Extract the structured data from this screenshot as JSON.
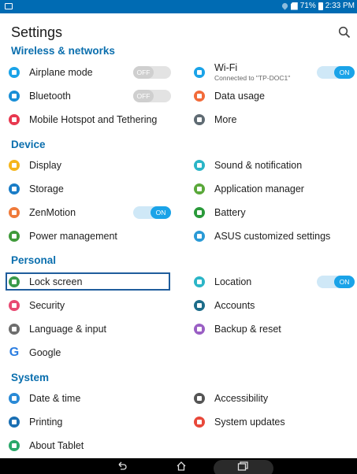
{
  "status_bar": {
    "battery": "71%",
    "time": "2:33 PM"
  },
  "header": {
    "title": "Settings",
    "search_icon": "search-icon"
  },
  "sections": {
    "wireless": "Wireless & networks",
    "device": "Device",
    "personal": "Personal",
    "system": "System"
  },
  "items": {
    "airplane": "Airplane mode",
    "wifi": "Wi-Fi",
    "wifi_sub": "Connected to \"TP-DOC1\"",
    "bluetooth": "Bluetooth",
    "data_usage": "Data usage",
    "hotspot": "Mobile Hotspot and Tethering",
    "more": "More",
    "display": "Display",
    "sound": "Sound & notification",
    "storage": "Storage",
    "app_manager": "Application manager",
    "zenmotion": "ZenMotion",
    "battery": "Battery",
    "power": "Power management",
    "asus_custom": "ASUS customized settings",
    "lock_screen": "Lock screen",
    "location": "Location",
    "security": "Security",
    "accounts": "Accounts",
    "language": "Language & input",
    "backup": "Backup & reset",
    "google": "Google",
    "date_time": "Date & time",
    "accessibility": "Accessibility",
    "printing": "Printing",
    "system_updates": "System updates",
    "about": "About Tablet"
  },
  "toggles": {
    "off": "OFF",
    "on": "ON"
  },
  "colors": {
    "accent": "#0b6fae",
    "status_bar": "#006bb3",
    "toggle_on": "#1aa3e8"
  }
}
